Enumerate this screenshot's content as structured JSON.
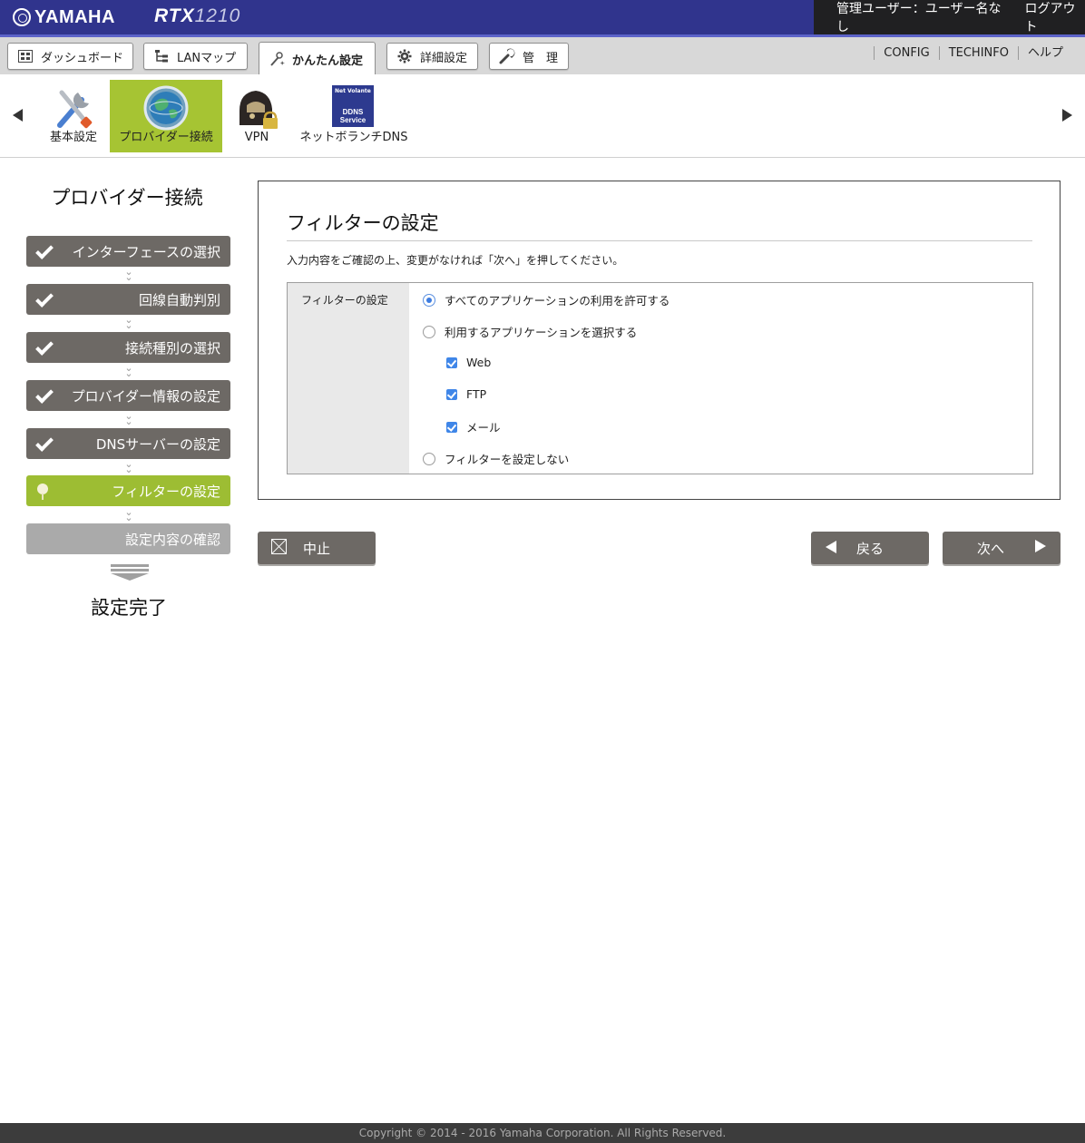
{
  "header": {
    "brand": "YAMAHA",
    "model_prefix": "RTX",
    "model_number": "1210",
    "user_label": "管理ユーザー：ユーザー名なし",
    "logout_label": "ログアウト"
  },
  "tabs": [
    {
      "label": "ダッシュボード",
      "icon": "dashboard-icon"
    },
    {
      "label": "LANマップ",
      "icon": "lanmap-icon"
    },
    {
      "label": "かんたん設定",
      "icon": "wand-icon",
      "active": true
    },
    {
      "label": "詳細設定",
      "icon": "gear-icon"
    },
    {
      "label": "管　理",
      "icon": "wrench-icon"
    }
  ],
  "top_links": [
    "CONFIG",
    "TECHINFO",
    "ヘルプ"
  ],
  "icon_strip": [
    {
      "label": "基本設定",
      "icon": "tools-icon"
    },
    {
      "label": "プロバイダー接続",
      "icon": "globe-icon",
      "active": true
    },
    {
      "label": "VPN",
      "icon": "vpn-lock-icon"
    },
    {
      "label": "ネットボランチDNS",
      "icon": "ddns-icon",
      "badge_top": "Net Volante",
      "badge_text": "DDNS Service"
    }
  ],
  "sidebar": {
    "title": "プロバイダー接続",
    "steps": [
      {
        "label": "インターフェースの選択",
        "state": "done"
      },
      {
        "label": "回線自動判別",
        "state": "done"
      },
      {
        "label": "接続種別の選択",
        "state": "done"
      },
      {
        "label": "プロバイダー情報の設定",
        "state": "done"
      },
      {
        "label": "DNSサーバーの設定",
        "state": "done"
      },
      {
        "label": "フィルターの設定",
        "state": "current"
      },
      {
        "label": "設定内容の確認",
        "state": "pending"
      }
    ],
    "done_label": "設定完了"
  },
  "main": {
    "title": "フィルターの設定",
    "description": "入力内容をご確認の上、変更がなければ「次へ」を押してください。",
    "field_label": "フィルターの設定",
    "options": {
      "allow_all": "すべてのアプリケーションの利用を許可する",
      "select_apps": "利用するアプリケーションを選択する",
      "app_web": "Web",
      "app_ftp": "FTP",
      "app_mail": "メール",
      "no_filter": "フィルターを設定しない"
    }
  },
  "buttons": {
    "cancel": "中止",
    "back": "戻る",
    "next": "次へ"
  },
  "footer": {
    "copyright": "Copyright © 2014 - 2016 Yamaha Corporation. All Rights Reserved."
  },
  "colors": {
    "header_blue": "#30348d",
    "accent_green": "#9dbd33",
    "step_gray": "#6d6965",
    "checkbox_blue": "#3f86e8"
  }
}
